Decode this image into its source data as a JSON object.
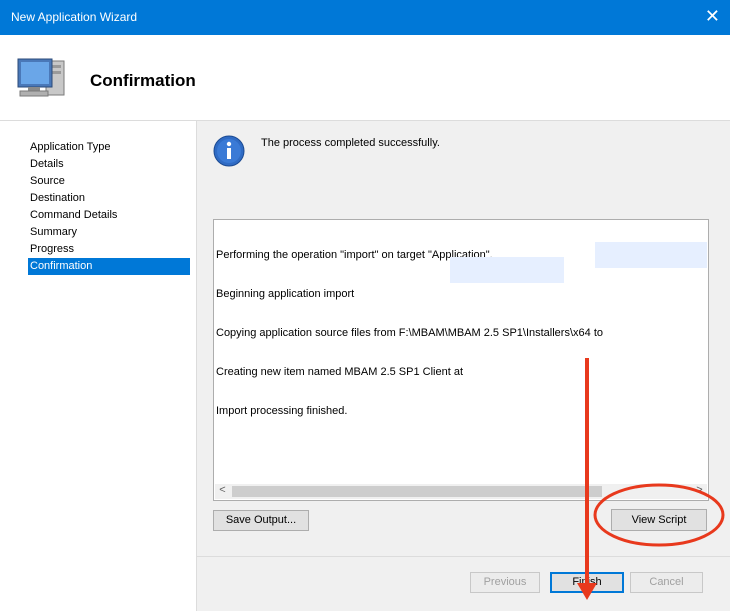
{
  "window": {
    "title": "New Application Wizard",
    "close_glyph": "✕"
  },
  "header": {
    "heading": "Confirmation",
    "icon": "computer-monitor-icon"
  },
  "sidebar": {
    "items": [
      {
        "label": "Application Type"
      },
      {
        "label": "Details"
      },
      {
        "label": "Source"
      },
      {
        "label": "Destination"
      },
      {
        "label": "Command Details"
      },
      {
        "label": "Summary"
      },
      {
        "label": "Progress"
      },
      {
        "label": "Confirmation",
        "active": true
      }
    ]
  },
  "main": {
    "status_text": "The process completed successfully.",
    "log_lines": [
      "Performing the operation \"import\" on target \"Application\".",
      "Beginning application import",
      "Copying application source files from F:\\MBAM\\MBAM 2.5 SP1\\Installers\\x64 to",
      "Creating new item named MBAM 2.5 SP1 Client at",
      "Import processing finished."
    ],
    "scroll_left": "<",
    "scroll_right": ">",
    "save_output_label": "Save Output...",
    "view_script_label": "View Script"
  },
  "footer": {
    "previous_label": "Previous",
    "finish_label": "Finish",
    "cancel_label": "Cancel"
  },
  "colors": {
    "accent": "#0078d7",
    "annotation": "#e8391d"
  }
}
